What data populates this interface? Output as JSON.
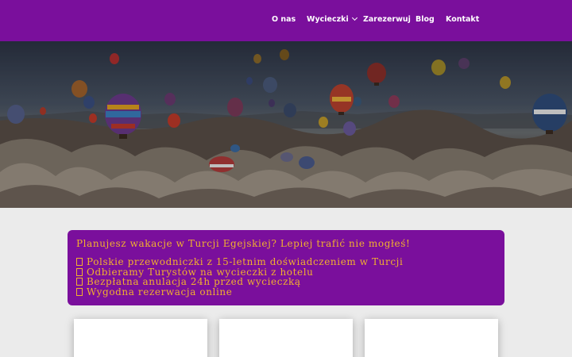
{
  "nav": {
    "items": [
      {
        "label": "O nas"
      },
      {
        "label": "Wycieczki"
      },
      {
        "label": "Zarezerwuj"
      },
      {
        "label": "Blog"
      },
      {
        "label": "Kontakt"
      }
    ]
  },
  "hero": {
    "image": "hot-air-balloons-over-cappadocia"
  },
  "promo": {
    "headline": "Planujesz wakacje w Turcji Egejskiej? Lepiej trafić nie mogłeś!",
    "features": [
      "Polskie przewodniczki z 15-letnim doświadczeniem w Turcji",
      "Odbieramy Turystów na wycieczki z hotelu",
      "Bezpłatna anulacja 24h przed wycieczką",
      "Wygodna rezerwacja online"
    ]
  },
  "colors": {
    "brand_purple": "#7a0f9c",
    "accent_gold": "#f2b12e",
    "page_background": "#ebebeb"
  }
}
